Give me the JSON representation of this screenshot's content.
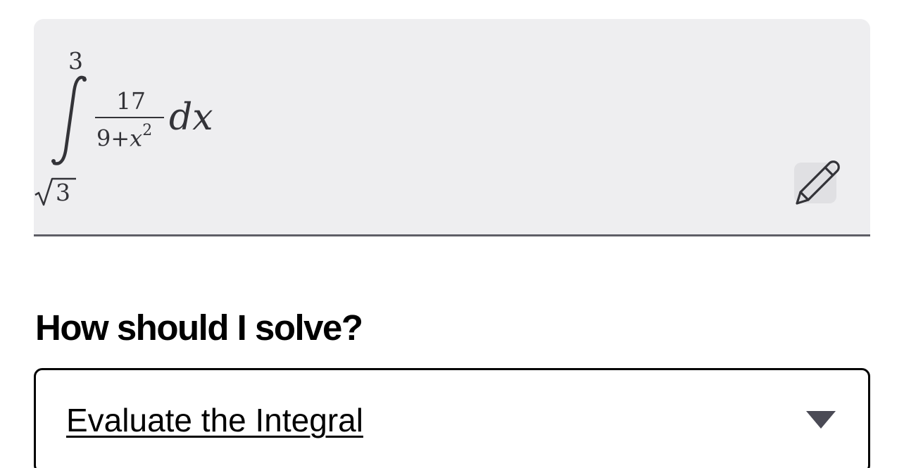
{
  "expression": {
    "upper_limit": "3",
    "lower_limit_radicand": "3",
    "numerator": "17",
    "denominator_constant": "9",
    "denominator_operator": "+",
    "denominator_variable": "x",
    "denominator_exponent": "2",
    "differential": "dx"
  },
  "solver": {
    "heading": "How should I solve?",
    "selected_method": "Evaluate the Integral"
  },
  "colors": {
    "math_box_background": "#eeeef0",
    "math_box_underline": "#5e5e66",
    "edit_button_background": "#e0e0e3",
    "text": "#000000",
    "chevron": "#4a4a55"
  },
  "icons": {
    "edit": "pencil-icon",
    "dropdown": "chevron-down-icon"
  }
}
